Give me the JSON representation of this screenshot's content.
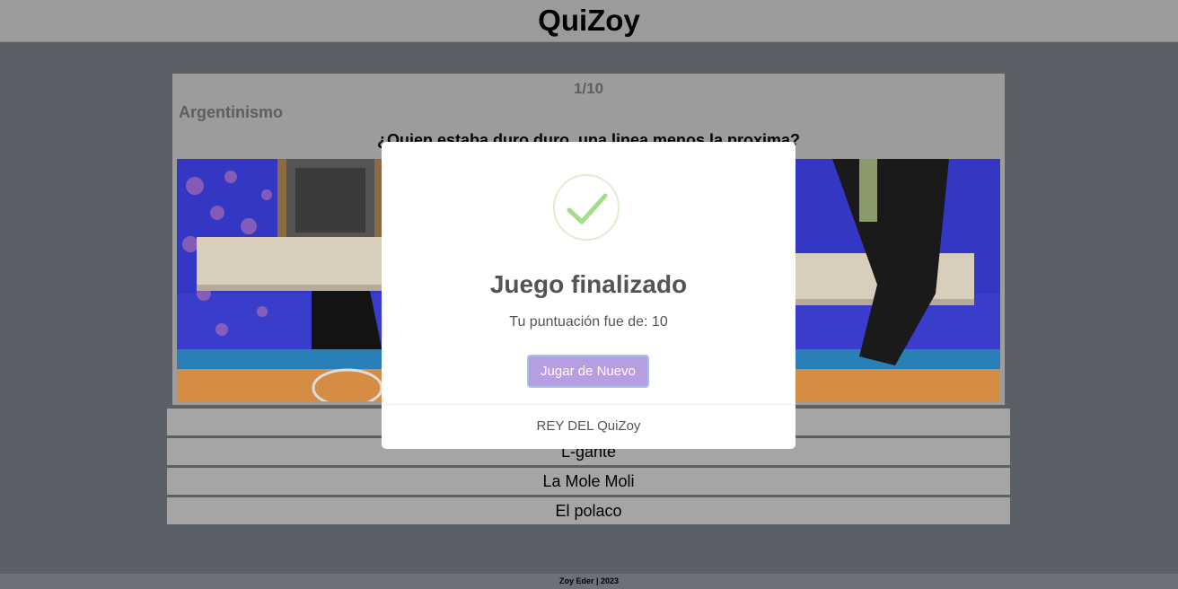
{
  "app": {
    "title": "QuiZoy"
  },
  "quiz": {
    "counter": "1/10",
    "category": "Argentinismo",
    "question": "¿Quien estaba duro duro, una linea menos la proxima?",
    "answers": [
      {
        "label": ""
      },
      {
        "label": "L-gante"
      },
      {
        "label": "La Mole Moli"
      },
      {
        "label": "El polaco"
      }
    ]
  },
  "modal": {
    "icon": "checkmark-icon",
    "title": "Juego finalizado",
    "text": "Tu puntuación fue de: 10",
    "button_label": "Jugar de Nuevo",
    "footer": "REY DEL QuiZoy"
  },
  "footer": {
    "text": "Zoy Eder | 2023"
  },
  "colors": {
    "accent_button": "#b79ee3",
    "success_check": "#a5dc86",
    "background": "#5b5f66"
  }
}
